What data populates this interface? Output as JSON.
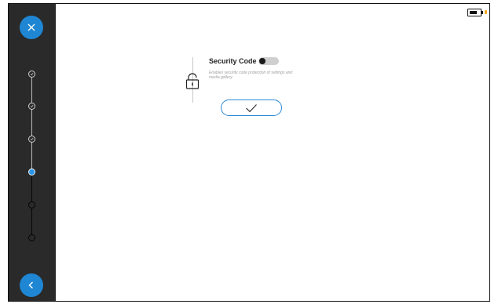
{
  "sidebar": {
    "close_button": {
      "icon": "close-icon"
    },
    "back_button": {
      "icon": "chevron-left-icon"
    },
    "steps": [
      {
        "state": "done",
        "icon": "check-icon"
      },
      {
        "state": "done",
        "icon": "check-icon"
      },
      {
        "state": "done",
        "icon": "check-icon"
      },
      {
        "state": "current"
      },
      {
        "state": "todo"
      },
      {
        "state": "todo"
      }
    ]
  },
  "status_bar": {
    "battery_icon": "battery-icon",
    "charging_color": "#f5a623"
  },
  "setting": {
    "icon": "lock-icon",
    "title": "Security Code",
    "toggle_on": false,
    "description": "Enables security code protection of settings and media gallery."
  },
  "confirm_button": {
    "icon": "check-icon"
  },
  "colors": {
    "accent": "#1f86d4",
    "sidebar": "#2a2a2a"
  }
}
